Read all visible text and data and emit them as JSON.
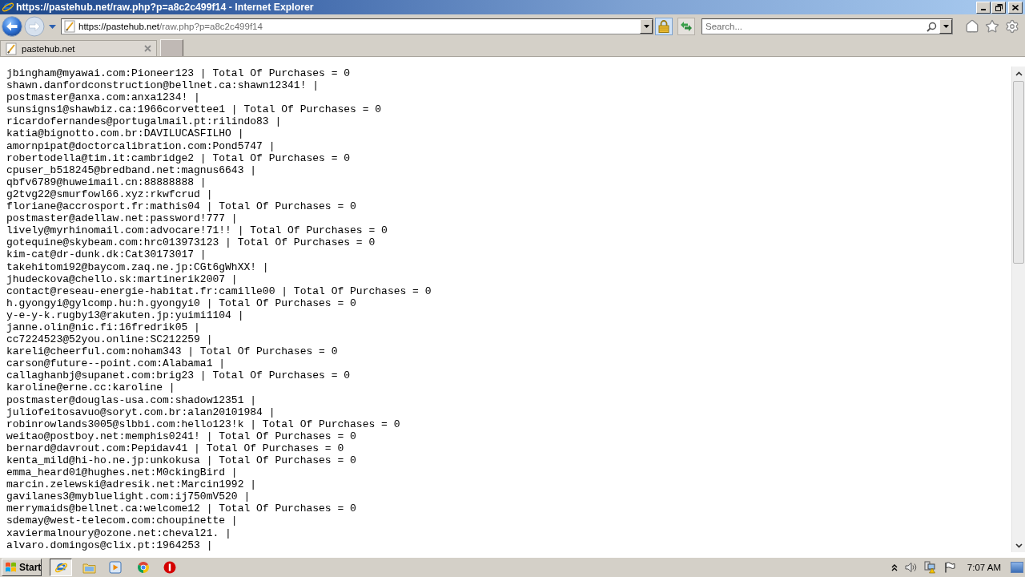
{
  "window": {
    "title": "https://pastehub.net/raw.php?p=a8c2c499f14 - Internet Explorer"
  },
  "address_bar": {
    "host": "https://pastehub.net",
    "path": "/raw.php?p=a8c2c499f14"
  },
  "search": {
    "placeholder": "Search..."
  },
  "tabs": [
    {
      "label": "pastehub.net",
      "selected": true
    }
  ],
  "paste_lines": [
    "jbingham@myawai.com:Pioneer123 | Total Of Purchases = 0",
    "shawn.danfordconstruction@bellnet.ca:shawn12341! |",
    "postmaster@anxa.com:anxa1234! |",
    "sunsigns1@shawbiz.ca:1966corvettee1 | Total Of Purchases = 0",
    "ricardofernandes@portugalmail.pt:rilindo83 |",
    "katia@bignotto.com.br:DAVILUCASFILHO |",
    "amornpipat@doctorcalibration.com:Pond5747 |",
    "robertodella@tim.it:cambridge2 | Total Of Purchases = 0",
    "cpuser_b518245@bredband.net:magnus6643 |",
    "qbfv6789@huweimail.cn:88888888 |",
    "g2tvg22@smurfowl66.xyz:rkwfcrud |",
    "floriane@accrosport.fr:mathis04 | Total Of Purchases = 0",
    "postmaster@adellaw.net:password!777 |",
    "lively@myrhinomail.com:advocare!71!! | Total Of Purchases = 0",
    "gotequine@skybeam.com:hrc013973123 | Total Of Purchases = 0",
    "kim-cat@dr-dunk.dk:Cat30173017 |",
    "takehitomi92@baycom.zaq.ne.jp:CGt6gWhXX! |",
    "jhudeckova@chello.sk:martinerik2007 |",
    "contact@reseau-energie-habitat.fr:camille00 | Total Of Purchases = 0",
    "h.gyongyi@gylcomp.hu:h.gyongyi0 | Total Of Purchases = 0",
    "y-e-y-k.rugby13@rakuten.jp:yuimi1104 |",
    "janne.olin@nic.fi:16fredrik05 |",
    "cc7224523@52you.online:SC212259 |",
    "kareli@cheerful.com:noham343 | Total Of Purchases = 0",
    "carson@future--point.com:Alabama1 |",
    "callaghanbj@supanet.com:brig23 | Total Of Purchases = 0",
    "karoline@erne.cc:karoline |",
    "postmaster@douglas-usa.com:shadow12351 |",
    "juliofeitosavuo@soryt.com.br:alan20101984 |",
    "robinrowlands3005@slbbi.com:hello123!k | Total Of Purchases = 0",
    "weitao@postboy.net:memphis0241! | Total Of Purchases = 0",
    "bernard@davrout.com:Pepidav41 | Total Of Purchases = 0",
    "kenta_mild@hi-ho.ne.jp:unkokusa | Total Of Purchases = 0",
    "emma_heard01@hughes.net:M0ckingBird |",
    "marcin.zelewski@adresik.net:Marcin1992 |",
    "gavilanes3@mybluelight.com:ij750mV520 |",
    "merrymaids@bellnet.ca:welcome12 | Total Of Purchases = 0",
    "sdemay@west-telecom.com:choupinette |",
    "xaviermalnoury@ozone.net:cheval21. |",
    "alvaro.domingos@clix.pt:1964253 |"
  ],
  "taskbar": {
    "start_label": "Start",
    "items": [
      {
        "kind": "browser",
        "selected": true
      },
      {
        "kind": "folder",
        "selected": false
      },
      {
        "kind": "player",
        "selected": false
      },
      {
        "kind": "chrome",
        "selected": false
      },
      {
        "kind": "alert",
        "selected": false
      }
    ],
    "clock": "7:07 AM"
  }
}
